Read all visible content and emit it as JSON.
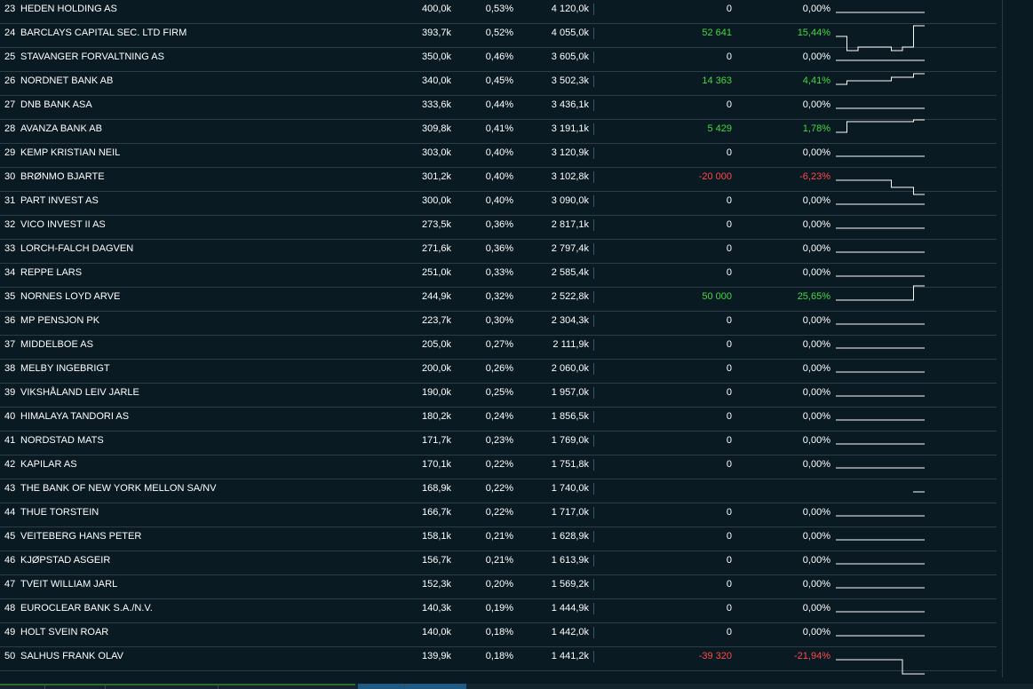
{
  "rows": [
    {
      "rank": "23",
      "name": "HEDEN HOLDING AS",
      "shares": "400,0k",
      "pct": "0,53%",
      "value": "4 120,0k",
      "change": "0",
      "change_pct": "0,00%",
      "trend": "flat",
      "spark": [
        0,
        0
      ]
    },
    {
      "rank": "24",
      "name": "BARCLAYS CAPITAL SEC. LTD FIRM",
      "shares": "393,7k",
      "pct": "0,52%",
      "value": "4 055,0k",
      "change": "52 641",
      "change_pct": "15,44%",
      "trend": "pos",
      "spark": [
        0,
        -4,
        -3,
        -3,
        -3,
        -4,
        -3,
        3
      ]
    },
    {
      "rank": "25",
      "name": "STAVANGER FORVALTNING AS",
      "shares": "350,0k",
      "pct": "0,46%",
      "value": "3 605,0k",
      "change": "0",
      "change_pct": "0,00%",
      "trend": "flat",
      "spark": [
        0,
        0
      ]
    },
    {
      "rank": "26",
      "name": "NORDNET BANK AB",
      "shares": "340,0k",
      "pct": "0,45%",
      "value": "3 502,3k",
      "change": "14 363",
      "change_pct": "4,41%",
      "trend": "pos",
      "spark": [
        0,
        1,
        1,
        1,
        1,
        2,
        2,
        3
      ]
    },
    {
      "rank": "27",
      "name": "DNB BANK ASA",
      "shares": "333,6k",
      "pct": "0,44%",
      "value": "3 436,1k",
      "change": "0",
      "change_pct": "0,00%",
      "trend": "flat",
      "spark": [
        0,
        0
      ]
    },
    {
      "rank": "28",
      "name": "AVANZA BANK AB",
      "shares": "309,8k",
      "pct": "0,41%",
      "value": "3 191,1k",
      "change": "5 429",
      "change_pct": "1,78%",
      "trend": "pos",
      "spark": [
        0,
        3,
        3,
        3,
        3,
        3,
        3,
        3.5
      ]
    },
    {
      "rank": "29",
      "name": "KEMP KRISTIAN NEIL",
      "shares": "303,0k",
      "pct": "0,40%",
      "value": "3 120,9k",
      "change": "0",
      "change_pct": "0,00%",
      "trend": "flat",
      "spark": [
        0,
        0
      ]
    },
    {
      "rank": "30",
      "name": "BRØNMO BJARTE",
      "shares": "301,2k",
      "pct": "0,40%",
      "value": "3 102,8k",
      "change": "-20 000",
      "change_pct": "-6,23%",
      "trend": "neg",
      "spark": [
        0,
        0,
        0,
        0,
        0,
        -2,
        -2,
        -4
      ]
    },
    {
      "rank": "31",
      "name": "PART INVEST AS",
      "shares": "300,0k",
      "pct": "0,40%",
      "value": "3 090,0k",
      "change": "0",
      "change_pct": "0,00%",
      "trend": "flat",
      "spark": [
        0,
        0
      ]
    },
    {
      "rank": "32",
      "name": "VICO INVEST II AS",
      "shares": "273,5k",
      "pct": "0,36%",
      "value": "2 817,1k",
      "change": "0",
      "change_pct": "0,00%",
      "trend": "flat",
      "spark": [
        0,
        0
      ]
    },
    {
      "rank": "33",
      "name": "LORCH-FALCH DAGVEN",
      "shares": "271,6k",
      "pct": "0,36%",
      "value": "2 797,4k",
      "change": "0",
      "change_pct": "0,00%",
      "trend": "flat",
      "spark": [
        0,
        0
      ]
    },
    {
      "rank": "34",
      "name": "REPPE LARS",
      "shares": "251,0k",
      "pct": "0,33%",
      "value": "2 585,4k",
      "change": "0",
      "change_pct": "0,00%",
      "trend": "flat",
      "spark": [
        0,
        0
      ]
    },
    {
      "rank": "35",
      "name": "NORNES LOYD ARVE",
      "shares": "244,9k",
      "pct": "0,32%",
      "value": "2 522,8k",
      "change": "50 000",
      "change_pct": "25,65%",
      "trend": "pos",
      "spark": [
        0,
        0,
        0,
        0,
        0,
        0,
        0,
        4
      ]
    },
    {
      "rank": "36",
      "name": "MP PENSJON PK",
      "shares": "223,7k",
      "pct": "0,30%",
      "value": "2 304,3k",
      "change": "0",
      "change_pct": "0,00%",
      "trend": "flat",
      "spark": [
        0,
        0
      ]
    },
    {
      "rank": "37",
      "name": "MIDDELBOE AS",
      "shares": "205,0k",
      "pct": "0,27%",
      "value": "2 111,9k",
      "change": "0",
      "change_pct": "0,00%",
      "trend": "flat",
      "spark": [
        0,
        0
      ]
    },
    {
      "rank": "38",
      "name": "MELBY INGEBRIGT",
      "shares": "200,0k",
      "pct": "0,26%",
      "value": "2 060,0k",
      "change": "0",
      "change_pct": "0,00%",
      "trend": "flat",
      "spark": [
        0,
        0
      ]
    },
    {
      "rank": "39",
      "name": "VIKSHÅLAND LEIV JARLE",
      "shares": "190,0k",
      "pct": "0,25%",
      "value": "1 957,0k",
      "change": "0",
      "change_pct": "0,00%",
      "trend": "flat",
      "spark": [
        0,
        0
      ]
    },
    {
      "rank": "40",
      "name": "HIMALAYA TANDORI AS",
      "shares": "180,2k",
      "pct": "0,24%",
      "value": "1 856,5k",
      "change": "0",
      "change_pct": "0,00%",
      "trend": "flat",
      "spark": [
        0,
        0
      ]
    },
    {
      "rank": "41",
      "name": "NORDSTAD MATS",
      "shares": "171,7k",
      "pct": "0,23%",
      "value": "1 769,0k",
      "change": "0",
      "change_pct": "0,00%",
      "trend": "flat",
      "spark": [
        0,
        0
      ]
    },
    {
      "rank": "42",
      "name": "KAPILAR AS",
      "shares": "170,1k",
      "pct": "0,22%",
      "value": "1 751,8k",
      "change": "0",
      "change_pct": "0,00%",
      "trend": "flat",
      "spark": [
        0,
        0
      ]
    },
    {
      "rank": "43",
      "name": "THE BANK OF NEW YORK MELLON SA/NV",
      "shares": "168,9k",
      "pct": "0,22%",
      "value": "1 740,0k",
      "change": "",
      "change_pct": "",
      "trend": "flat",
      "spark": [
        0,
        0
      ],
      "spark_tail_only": true
    },
    {
      "rank": "44",
      "name": "THUE TORSTEIN",
      "shares": "166,7k",
      "pct": "0,22%",
      "value": "1 717,0k",
      "change": "0",
      "change_pct": "0,00%",
      "trend": "flat",
      "spark": [
        0,
        0
      ]
    },
    {
      "rank": "45",
      "name": "VEITEBERG HANS PETER",
      "shares": "158,1k",
      "pct": "0,21%",
      "value": "1 628,9k",
      "change": "0",
      "change_pct": "0,00%",
      "trend": "flat",
      "spark": [
        0,
        0
      ]
    },
    {
      "rank": "46",
      "name": "KJØPSTAD ASGEIR",
      "shares": "156,7k",
      "pct": "0,21%",
      "value": "1 613,9k",
      "change": "0",
      "change_pct": "0,00%",
      "trend": "flat",
      "spark": [
        0,
        0
      ]
    },
    {
      "rank": "47",
      "name": "TVEIT WILLIAM JARL",
      "shares": "152,3k",
      "pct": "0,20%",
      "value": "1 569,2k",
      "change": "0",
      "change_pct": "0,00%",
      "trend": "flat",
      "spark": [
        0,
        0
      ]
    },
    {
      "rank": "48",
      "name": "EUROCLEAR BANK S.A./N.V.",
      "shares": "140,3k",
      "pct": "0,19%",
      "value": "1 444,9k",
      "change": "0",
      "change_pct": "0,00%",
      "trend": "flat",
      "spark": [
        0,
        0
      ]
    },
    {
      "rank": "49",
      "name": "HOLT SVEIN ROAR",
      "shares": "140,0k",
      "pct": "0,18%",
      "value": "1 442,0k",
      "change": "0",
      "change_pct": "0,00%",
      "trend": "flat",
      "spark": [
        0,
        0
      ]
    },
    {
      "rank": "50",
      "name": "SALHUS FRANK OLAV",
      "shares": "139,9k",
      "pct": "0,18%",
      "value": "1 441,2k",
      "change": "-39 320",
      "change_pct": "-21,94%",
      "trend": "neg",
      "spark": [
        0,
        0,
        0,
        0,
        0,
        0,
        -4,
        -4
      ]
    }
  ],
  "colors": {
    "positive": "#45d945",
    "negative": "#ff4a4a",
    "neutral": "#ffffff",
    "background": "#0a1a22",
    "row_divider": "#2c3d45"
  }
}
